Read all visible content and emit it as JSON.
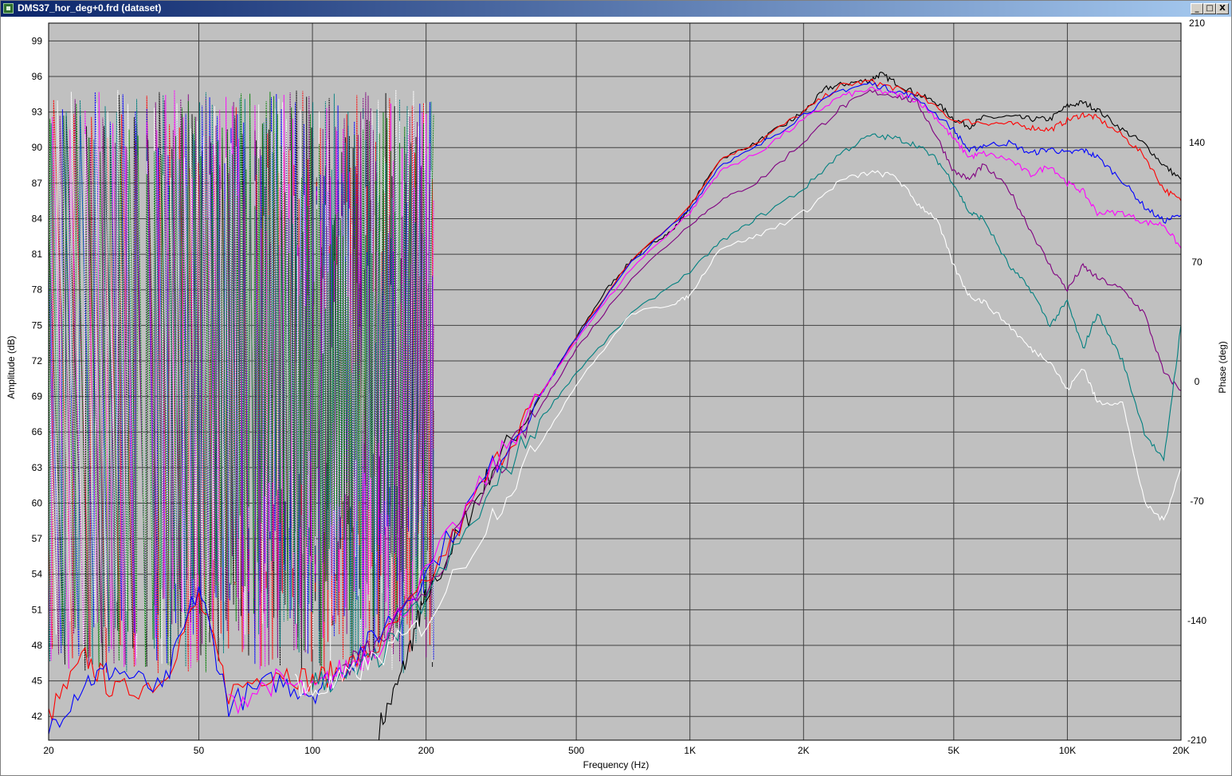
{
  "window": {
    "title": "DMS37_hor_deg+0.frd (dataset)",
    "buttons": {
      "minimize": "_",
      "maximize": "□",
      "close": "X"
    }
  },
  "chart_data": {
    "type": "line",
    "xscale": "log",
    "xlim": [
      20,
      20000
    ],
    "ylim": [
      40,
      100.5
    ],
    "y2lim": [
      -210,
      210
    ],
    "xlabel": "Frequency (Hz)",
    "ylabel": "Amplitude (dB)",
    "y2label": "Phase (deg)",
    "grid": true,
    "x_ticks": [
      "20",
      "50",
      "100",
      "200",
      "500",
      "1K",
      "2K",
      "5K",
      "10K",
      "20K"
    ],
    "x_tick_values": [
      20,
      50,
      100,
      200,
      500,
      1000,
      2000,
      5000,
      10000,
      20000
    ],
    "y_ticks": [
      42,
      45,
      48,
      51,
      54,
      57,
      60,
      63,
      66,
      69,
      72,
      75,
      78,
      81,
      84,
      87,
      90,
      93,
      96,
      99
    ],
    "y2_ticks": [
      -210,
      -140,
      -70,
      0,
      70,
      140,
      210
    ],
    "colors": {
      "background": "#c0c0c0",
      "grid": "#404040"
    },
    "amplitude_series": [
      {
        "color": "#000000",
        "x": [
          150,
          170,
          190,
          200,
          250,
          300,
          400,
          500,
          600,
          700,
          800,
          900,
          1000,
          1200,
          1500,
          1800,
          2000,
          2300,
          2600,
          3000,
          3200,
          3500,
          4000,
          4500,
          5000,
          5500,
          6000,
          7000,
          8000,
          9000,
          10000,
          11000,
          12000,
          14000,
          16000,
          18000,
          20000
        ],
        "y": [
          41,
          45,
          50,
          52,
          58,
          63,
          69,
          74,
          78,
          80.5,
          82,
          83,
          85,
          89,
          90.4,
          92,
          93,
          95,
          95.4,
          95.7,
          96.2,
          95.5,
          94.5,
          93.8,
          92.4,
          91.8,
          92.5,
          92.6,
          92.4,
          92.4,
          93.5,
          93.8,
          93.2,
          91.5,
          90.3,
          88.5,
          87.3
        ]
      },
      {
        "color": "#ff0000",
        "x": [
          20,
          25,
          30,
          40,
          50,
          60,
          80,
          100,
          120,
          150,
          200,
          300,
          400,
          500,
          700,
          1000,
          1200,
          1500,
          2000,
          2500,
          3000,
          3500,
          4000,
          5000,
          6000,
          7000,
          8000,
          9000,
          10000,
          11000,
          12000,
          14000,
          16000,
          18000,
          20000
        ],
        "y": [
          42,
          47,
          44,
          45,
          52,
          44,
          46,
          45,
          46,
          48,
          53,
          63,
          69,
          74,
          80.5,
          85,
          89,
          90.4,
          93,
          95.2,
          95.6,
          95,
          94.5,
          92.3,
          92.1,
          92,
          91.7,
          91.5,
          92.3,
          92.8,
          92.5,
          91,
          89.3,
          86.5,
          85.5
        ]
      },
      {
        "color": "#0000ff",
        "x": [
          20,
          25,
          30,
          40,
          50,
          60,
          80,
          100,
          120,
          150,
          200,
          300,
          400,
          500,
          700,
          1000,
          1200,
          1500,
          2000,
          2500,
          3000,
          3500,
          4000,
          5000,
          5500,
          6000,
          7000,
          8000,
          9000,
          10000,
          11000,
          12000,
          14000,
          16000,
          18000,
          20000
        ],
        "y": [
          41,
          45,
          46,
          44,
          53,
          43,
          45,
          44,
          46,
          49,
          54,
          63,
          69,
          74,
          80.3,
          84.8,
          88.5,
          90,
          92.8,
          94.8,
          95.4,
          94.8,
          94.2,
          91.5,
          89.7,
          90.2,
          90.4,
          89.5,
          89.9,
          89.5,
          89.8,
          89.2,
          87.2,
          85,
          83.8,
          84.3
        ]
      },
      {
        "color": "#ff00ff",
        "x": [
          60,
          80,
          100,
          120,
          150,
          200,
          300,
          400,
          500,
          700,
          1000,
          1200,
          1500,
          2000,
          2500,
          3000,
          3500,
          4000,
          4500,
          5000,
          5500,
          6000,
          7000,
          8000,
          9000,
          10000,
          11000,
          12000,
          14000,
          16000,
          18000,
          20000
        ],
        "y": [
          43,
          45,
          44,
          46,
          48,
          54,
          63,
          69,
          73.8,
          79.8,
          84.5,
          88,
          89.5,
          92.3,
          94.3,
          94.9,
          94.5,
          94,
          92.5,
          90.7,
          89.2,
          89.5,
          89,
          87.7,
          88.5,
          87,
          86.3,
          84.5,
          84.5,
          83.7,
          83.5,
          81.5
        ]
      },
      {
        "color": "#800080",
        "x": [
          120,
          150,
          200,
          300,
          400,
          500,
          700,
          1000,
          1200,
          1500,
          2000,
          2500,
          3000,
          3500,
          4000,
          4500,
          5000,
          5500,
          6000,
          7000,
          8000,
          9000,
          10000,
          11000,
          12000,
          14000,
          16000,
          18000,
          20000
        ],
        "y": [
          46,
          48,
          53,
          62,
          68,
          73,
          79,
          83.5,
          85.5,
          87,
          90.5,
          93.3,
          94.7,
          94.4,
          93.8,
          91,
          88,
          87.3,
          88.5,
          86.5,
          83,
          80,
          78,
          80,
          79,
          78,
          76,
          71,
          69.5
        ]
      },
      {
        "color": "#008080",
        "x": [
          100,
          120,
          150,
          200,
          300,
          400,
          500,
          700,
          1000,
          1200,
          1500,
          2000,
          2500,
          3000,
          3500,
          4000,
          4500,
          5000,
          5500,
          6000,
          7000,
          8000,
          9000,
          10000,
          11000,
          12000,
          14000,
          16000,
          18000,
          20000
        ],
        "y": [
          45,
          45,
          47,
          52,
          61,
          67,
          71,
          76,
          79.5,
          82,
          84,
          86.5,
          89.5,
          91,
          90.8,
          90.2,
          89,
          87,
          84.5,
          84,
          80,
          78,
          75,
          77,
          73,
          76,
          72,
          66,
          63.5,
          75
        ]
      },
      {
        "color": "#ffffff",
        "x": [
          90,
          100,
          120,
          150,
          200,
          300,
          400,
          500,
          700,
          900,
          1000,
          1200,
          1500,
          2000,
          2500,
          3000,
          3500,
          4000,
          4500,
          5000,
          5500,
          6000,
          7000,
          8000,
          9000,
          10000,
          11000,
          12000,
          14000,
          16000,
          18000,
          20000
        ],
        "y": [
          45,
          44,
          45,
          47,
          50,
          59,
          65,
          70,
          76,
          76.8,
          77.5,
          81.5,
          82.5,
          84.5,
          87.2,
          87.9,
          87.6,
          85.3,
          84,
          80,
          77.5,
          77,
          75,
          73,
          72,
          69.5,
          71.5,
          68.5,
          68.5,
          60,
          58.5,
          63
        ]
      }
    ],
    "phase_series_colors": [
      "#000000",
      "#ff0000",
      "#0000ff",
      "#ff00ff",
      "#800080",
      "#008080",
      "#ffffff",
      "#008000",
      "#808080",
      "#c0c0c0"
    ]
  }
}
